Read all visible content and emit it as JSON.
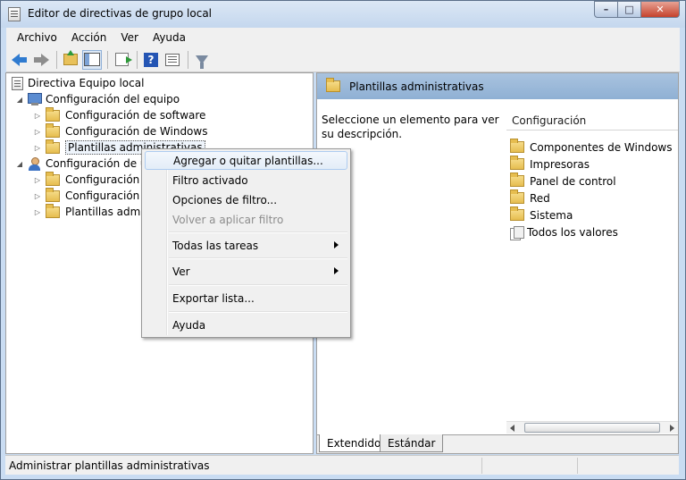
{
  "window": {
    "title": "Editor de directivas de grupo local"
  },
  "menubar": {
    "items": [
      "Archivo",
      "Acción",
      "Ver",
      "Ayuda"
    ]
  },
  "tree": {
    "root": "Directiva Equipo local",
    "computer": "Configuración del equipo",
    "computer_children": [
      "Configuración de software",
      "Configuración de Windows",
      "Plantillas administrativas"
    ],
    "user": "Configuración de us",
    "user_children": [
      "Configuración d",
      "Configuración d",
      "Plantillas admini"
    ]
  },
  "right_pane": {
    "header": "Plantillas administrativas",
    "description": "Seleccione un elemento para ver su descripción.",
    "column_header": "Configuración",
    "items": [
      "Componentes de Windows",
      "Impresoras",
      "Panel de control",
      "Red",
      "Sistema",
      "Todos los valores"
    ],
    "tabs": [
      "Extendido",
      "Estándar"
    ]
  },
  "context_menu": {
    "items": [
      {
        "label": "Agregar o quitar plantillas..."
      },
      {
        "label": "Filtro activado"
      },
      {
        "label": "Opciones de filtro..."
      },
      {
        "label": "Volver a aplicar filtro"
      },
      {
        "label": "Todas las tareas"
      },
      {
        "label": "Ver"
      },
      {
        "label": "Exportar lista..."
      },
      {
        "label": "Ayuda"
      }
    ]
  },
  "statusbar": {
    "text": "Administrar plantillas administrativas"
  },
  "colors": {
    "header_blue": "#a9c3df",
    "close_red": "#c4422c",
    "frame_blue": "#c9dcf2"
  }
}
